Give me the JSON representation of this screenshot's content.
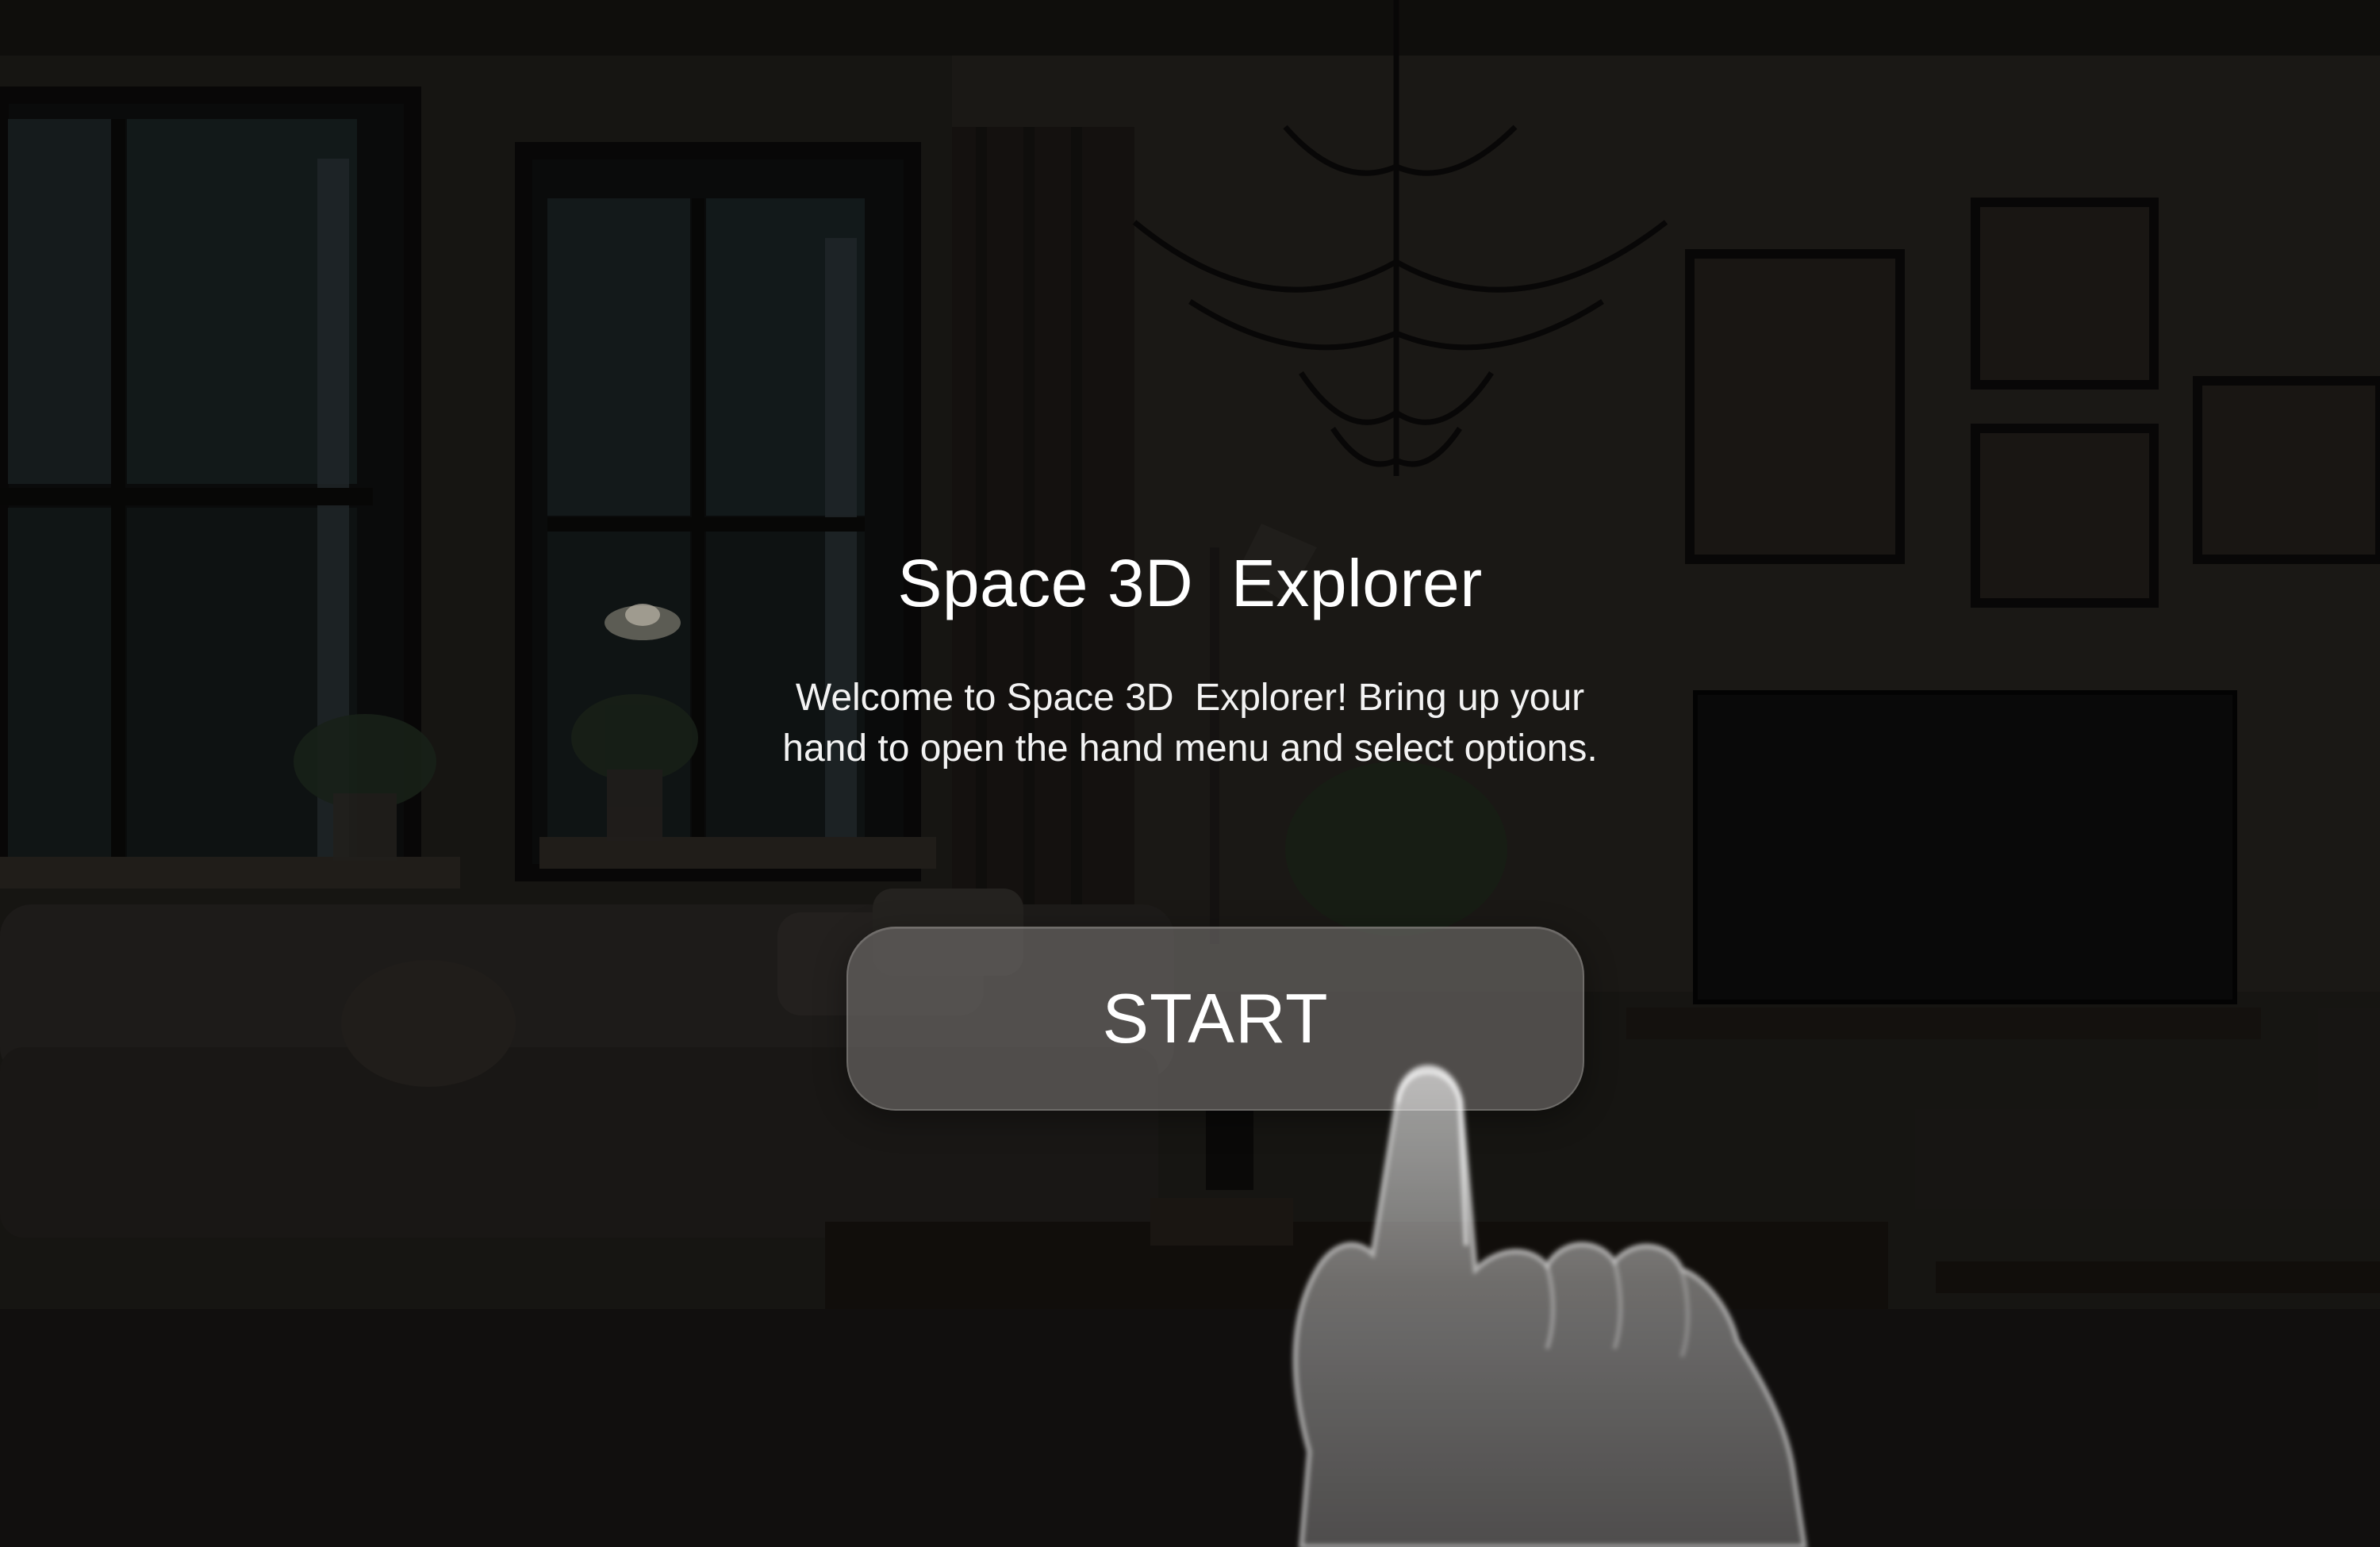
{
  "app": {
    "title": "Space 3D  Explorer"
  },
  "intro": {
    "welcome_line1": "Welcome to Space 3D  Explorer! Bring up your",
    "welcome_line2": "hand to open the hand menu and select options."
  },
  "actions": {
    "start_label": "START"
  },
  "icons": {
    "pointer": "hand-pointer-icon"
  },
  "colors": {
    "text": "#ffffff",
    "button_fill": "#787673"
  }
}
